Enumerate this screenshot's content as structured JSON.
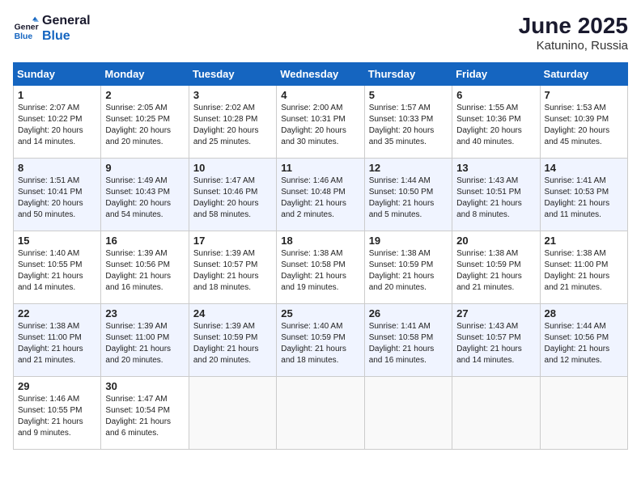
{
  "header": {
    "logo_line1": "General",
    "logo_line2": "Blue",
    "month": "June 2025",
    "location": "Katunino, Russia"
  },
  "days_of_week": [
    "Sunday",
    "Monday",
    "Tuesday",
    "Wednesday",
    "Thursday",
    "Friday",
    "Saturday"
  ],
  "weeks": [
    [
      {
        "day": "1",
        "lines": [
          "Sunrise: 2:07 AM",
          "Sunset: 10:22 PM",
          "Daylight: 20 hours",
          "and 14 minutes."
        ]
      },
      {
        "day": "2",
        "lines": [
          "Sunrise: 2:05 AM",
          "Sunset: 10:25 PM",
          "Daylight: 20 hours",
          "and 20 minutes."
        ]
      },
      {
        "day": "3",
        "lines": [
          "Sunrise: 2:02 AM",
          "Sunset: 10:28 PM",
          "Daylight: 20 hours",
          "and 25 minutes."
        ]
      },
      {
        "day": "4",
        "lines": [
          "Sunrise: 2:00 AM",
          "Sunset: 10:31 PM",
          "Daylight: 20 hours",
          "and 30 minutes."
        ]
      },
      {
        "day": "5",
        "lines": [
          "Sunrise: 1:57 AM",
          "Sunset: 10:33 PM",
          "Daylight: 20 hours",
          "and 35 minutes."
        ]
      },
      {
        "day": "6",
        "lines": [
          "Sunrise: 1:55 AM",
          "Sunset: 10:36 PM",
          "Daylight: 20 hours",
          "and 40 minutes."
        ]
      },
      {
        "day": "7",
        "lines": [
          "Sunrise: 1:53 AM",
          "Sunset: 10:39 PM",
          "Daylight: 20 hours",
          "and 45 minutes."
        ]
      }
    ],
    [
      {
        "day": "8",
        "lines": [
          "Sunrise: 1:51 AM",
          "Sunset: 10:41 PM",
          "Daylight: 20 hours",
          "and 50 minutes."
        ]
      },
      {
        "day": "9",
        "lines": [
          "Sunrise: 1:49 AM",
          "Sunset: 10:43 PM",
          "Daylight: 20 hours",
          "and 54 minutes."
        ]
      },
      {
        "day": "10",
        "lines": [
          "Sunrise: 1:47 AM",
          "Sunset: 10:46 PM",
          "Daylight: 20 hours",
          "and 58 minutes."
        ]
      },
      {
        "day": "11",
        "lines": [
          "Sunrise: 1:46 AM",
          "Sunset: 10:48 PM",
          "Daylight: 21 hours",
          "and 2 minutes."
        ]
      },
      {
        "day": "12",
        "lines": [
          "Sunrise: 1:44 AM",
          "Sunset: 10:50 PM",
          "Daylight: 21 hours",
          "and 5 minutes."
        ]
      },
      {
        "day": "13",
        "lines": [
          "Sunrise: 1:43 AM",
          "Sunset: 10:51 PM",
          "Daylight: 21 hours",
          "and 8 minutes."
        ]
      },
      {
        "day": "14",
        "lines": [
          "Sunrise: 1:41 AM",
          "Sunset: 10:53 PM",
          "Daylight: 21 hours",
          "and 11 minutes."
        ]
      }
    ],
    [
      {
        "day": "15",
        "lines": [
          "Sunrise: 1:40 AM",
          "Sunset: 10:55 PM",
          "Daylight: 21 hours",
          "and 14 minutes."
        ]
      },
      {
        "day": "16",
        "lines": [
          "Sunrise: 1:39 AM",
          "Sunset: 10:56 PM",
          "Daylight: 21 hours",
          "and 16 minutes."
        ]
      },
      {
        "day": "17",
        "lines": [
          "Sunrise: 1:39 AM",
          "Sunset: 10:57 PM",
          "Daylight: 21 hours",
          "and 18 minutes."
        ]
      },
      {
        "day": "18",
        "lines": [
          "Sunrise: 1:38 AM",
          "Sunset: 10:58 PM",
          "Daylight: 21 hours",
          "and 19 minutes."
        ]
      },
      {
        "day": "19",
        "lines": [
          "Sunrise: 1:38 AM",
          "Sunset: 10:59 PM",
          "Daylight: 21 hours",
          "and 20 minutes."
        ]
      },
      {
        "day": "20",
        "lines": [
          "Sunrise: 1:38 AM",
          "Sunset: 10:59 PM",
          "Daylight: 21 hours",
          "and 21 minutes."
        ]
      },
      {
        "day": "21",
        "lines": [
          "Sunrise: 1:38 AM",
          "Sunset: 11:00 PM",
          "Daylight: 21 hours",
          "and 21 minutes."
        ]
      }
    ],
    [
      {
        "day": "22",
        "lines": [
          "Sunrise: 1:38 AM",
          "Sunset: 11:00 PM",
          "Daylight: 21 hours",
          "and 21 minutes."
        ]
      },
      {
        "day": "23",
        "lines": [
          "Sunrise: 1:39 AM",
          "Sunset: 11:00 PM",
          "Daylight: 21 hours",
          "and 20 minutes."
        ]
      },
      {
        "day": "24",
        "lines": [
          "Sunrise: 1:39 AM",
          "Sunset: 10:59 PM",
          "Daylight: 21 hours",
          "and 20 minutes."
        ]
      },
      {
        "day": "25",
        "lines": [
          "Sunrise: 1:40 AM",
          "Sunset: 10:59 PM",
          "Daylight: 21 hours",
          "and 18 minutes."
        ]
      },
      {
        "day": "26",
        "lines": [
          "Sunrise: 1:41 AM",
          "Sunset: 10:58 PM",
          "Daylight: 21 hours",
          "and 16 minutes."
        ]
      },
      {
        "day": "27",
        "lines": [
          "Sunrise: 1:43 AM",
          "Sunset: 10:57 PM",
          "Daylight: 21 hours",
          "and 14 minutes."
        ]
      },
      {
        "day": "28",
        "lines": [
          "Sunrise: 1:44 AM",
          "Sunset: 10:56 PM",
          "Daylight: 21 hours",
          "and 12 minutes."
        ]
      }
    ],
    [
      {
        "day": "29",
        "lines": [
          "Sunrise: 1:46 AM",
          "Sunset: 10:55 PM",
          "Daylight: 21 hours",
          "and 9 minutes."
        ]
      },
      {
        "day": "30",
        "lines": [
          "Sunrise: 1:47 AM",
          "Sunset: 10:54 PM",
          "Daylight: 21 hours",
          "and 6 minutes."
        ]
      },
      {
        "day": "",
        "lines": []
      },
      {
        "day": "",
        "lines": []
      },
      {
        "day": "",
        "lines": []
      },
      {
        "day": "",
        "lines": []
      },
      {
        "day": "",
        "lines": []
      }
    ]
  ]
}
